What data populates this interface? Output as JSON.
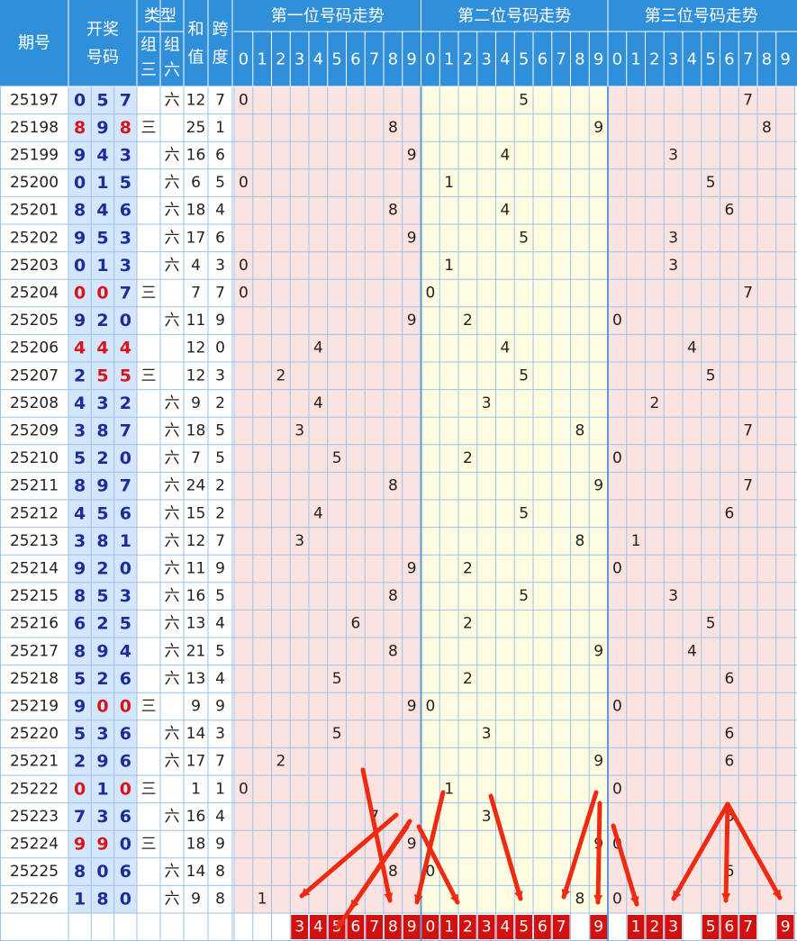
{
  "chart_data": {
    "type": "table",
    "headers": {
      "issue": "期号",
      "draw": "开奖号码",
      "type": "类型",
      "type_sub": [
        "组三",
        "组六"
      ],
      "sum": "和值",
      "span": "跨度",
      "pos1": "第一位号码走势",
      "pos2": "第二位号码走势",
      "pos3": "第三位号码走势",
      "digits": [
        "0",
        "1",
        "2",
        "3",
        "4",
        "5",
        "6",
        "7",
        "8",
        "9"
      ]
    },
    "labels": {
      "zu3": "三",
      "zu6": "六"
    },
    "rows": [
      {
        "issue": "25197",
        "digits": [
          0,
          5,
          7
        ],
        "type": "六",
        "sum": 12,
        "span": 7
      },
      {
        "issue": "25198",
        "digits": [
          8,
          9,
          8
        ],
        "type": "三",
        "sum": 25,
        "span": 1
      },
      {
        "issue": "25199",
        "digits": [
          9,
          4,
          3
        ],
        "type": "六",
        "sum": 16,
        "span": 6
      },
      {
        "issue": "25200",
        "digits": [
          0,
          1,
          5
        ],
        "type": "六",
        "sum": 6,
        "span": 5
      },
      {
        "issue": "25201",
        "digits": [
          8,
          4,
          6
        ],
        "type": "六",
        "sum": 18,
        "span": 4
      },
      {
        "issue": "25202",
        "digits": [
          9,
          5,
          3
        ],
        "type": "六",
        "sum": 17,
        "span": 6
      },
      {
        "issue": "25203",
        "digits": [
          0,
          1,
          3
        ],
        "type": "六",
        "sum": 4,
        "span": 3
      },
      {
        "issue": "25204",
        "digits": [
          0,
          0,
          7
        ],
        "type": "三",
        "sum": 7,
        "span": 7
      },
      {
        "issue": "25205",
        "digits": [
          9,
          2,
          0
        ],
        "type": "六",
        "sum": 11,
        "span": 9
      },
      {
        "issue": "25206",
        "digits": [
          4,
          4,
          4
        ],
        "type": "",
        "sum": 12,
        "span": 0
      },
      {
        "issue": "25207",
        "digits": [
          2,
          5,
          5
        ],
        "type": "三",
        "sum": 12,
        "span": 3
      },
      {
        "issue": "25208",
        "digits": [
          4,
          3,
          2
        ],
        "type": "六",
        "sum": 9,
        "span": 2
      },
      {
        "issue": "25209",
        "digits": [
          3,
          8,
          7
        ],
        "type": "六",
        "sum": 18,
        "span": 5
      },
      {
        "issue": "25210",
        "digits": [
          5,
          2,
          0
        ],
        "type": "六",
        "sum": 7,
        "span": 5
      },
      {
        "issue": "25211",
        "digits": [
          8,
          9,
          7
        ],
        "type": "六",
        "sum": 24,
        "span": 2
      },
      {
        "issue": "25212",
        "digits": [
          4,
          5,
          6
        ],
        "type": "六",
        "sum": 15,
        "span": 2
      },
      {
        "issue": "25213",
        "digits": [
          3,
          8,
          1
        ],
        "type": "六",
        "sum": 12,
        "span": 7
      },
      {
        "issue": "25214",
        "digits": [
          9,
          2,
          0
        ],
        "type": "六",
        "sum": 11,
        "span": 9
      },
      {
        "issue": "25215",
        "digits": [
          8,
          5,
          3
        ],
        "type": "六",
        "sum": 16,
        "span": 5
      },
      {
        "issue": "25216",
        "digits": [
          6,
          2,
          5
        ],
        "type": "六",
        "sum": 13,
        "span": 4
      },
      {
        "issue": "25217",
        "digits": [
          8,
          9,
          4
        ],
        "type": "六",
        "sum": 21,
        "span": 5
      },
      {
        "issue": "25218",
        "digits": [
          5,
          2,
          6
        ],
        "type": "六",
        "sum": 13,
        "span": 4
      },
      {
        "issue": "25219",
        "digits": [
          9,
          0,
          0
        ],
        "type": "三",
        "sum": 9,
        "span": 9
      },
      {
        "issue": "25220",
        "digits": [
          5,
          3,
          6
        ],
        "type": "六",
        "sum": 14,
        "span": 3
      },
      {
        "issue": "25221",
        "digits": [
          2,
          9,
          6
        ],
        "type": "六",
        "sum": 17,
        "span": 7
      },
      {
        "issue": "25222",
        "digits": [
          0,
          1,
          0
        ],
        "type": "三",
        "sum": 1,
        "span": 1
      },
      {
        "issue": "25223",
        "digits": [
          7,
          3,
          6
        ],
        "type": "六",
        "sum": 16,
        "span": 4
      },
      {
        "issue": "25224",
        "digits": [
          9,
          9,
          0
        ],
        "type": "三",
        "sum": 18,
        "span": 9
      },
      {
        "issue": "25225",
        "digits": [
          8,
          0,
          6
        ],
        "type": "六",
        "sum": 14,
        "span": 8
      },
      {
        "issue": "25226",
        "digits": [
          1,
          8,
          0
        ],
        "type": "六",
        "sum": 9,
        "span": 8
      }
    ],
    "predicted": [
      [
        3,
        4,
        5,
        6,
        7,
        8,
        9
      ],
      [
        0,
        1,
        2,
        3,
        4,
        5,
        6,
        7,
        9
      ],
      [
        1,
        2,
        3,
        5,
        6,
        7,
        9
      ]
    ],
    "colors": {
      "header_bg": "#2f8fd8",
      "header_text": "#ffffff",
      "draw_bg": "#d3e6fb",
      "draw_blue": "#1d2c9b",
      "draw_red": "#d7141a",
      "pos_pink": "#fde3df",
      "pos_yellow": "#fffde1",
      "grid": "#9cc3ea",
      "predict_red": "#d21010",
      "arrow_red": "#ee2a12"
    }
  }
}
